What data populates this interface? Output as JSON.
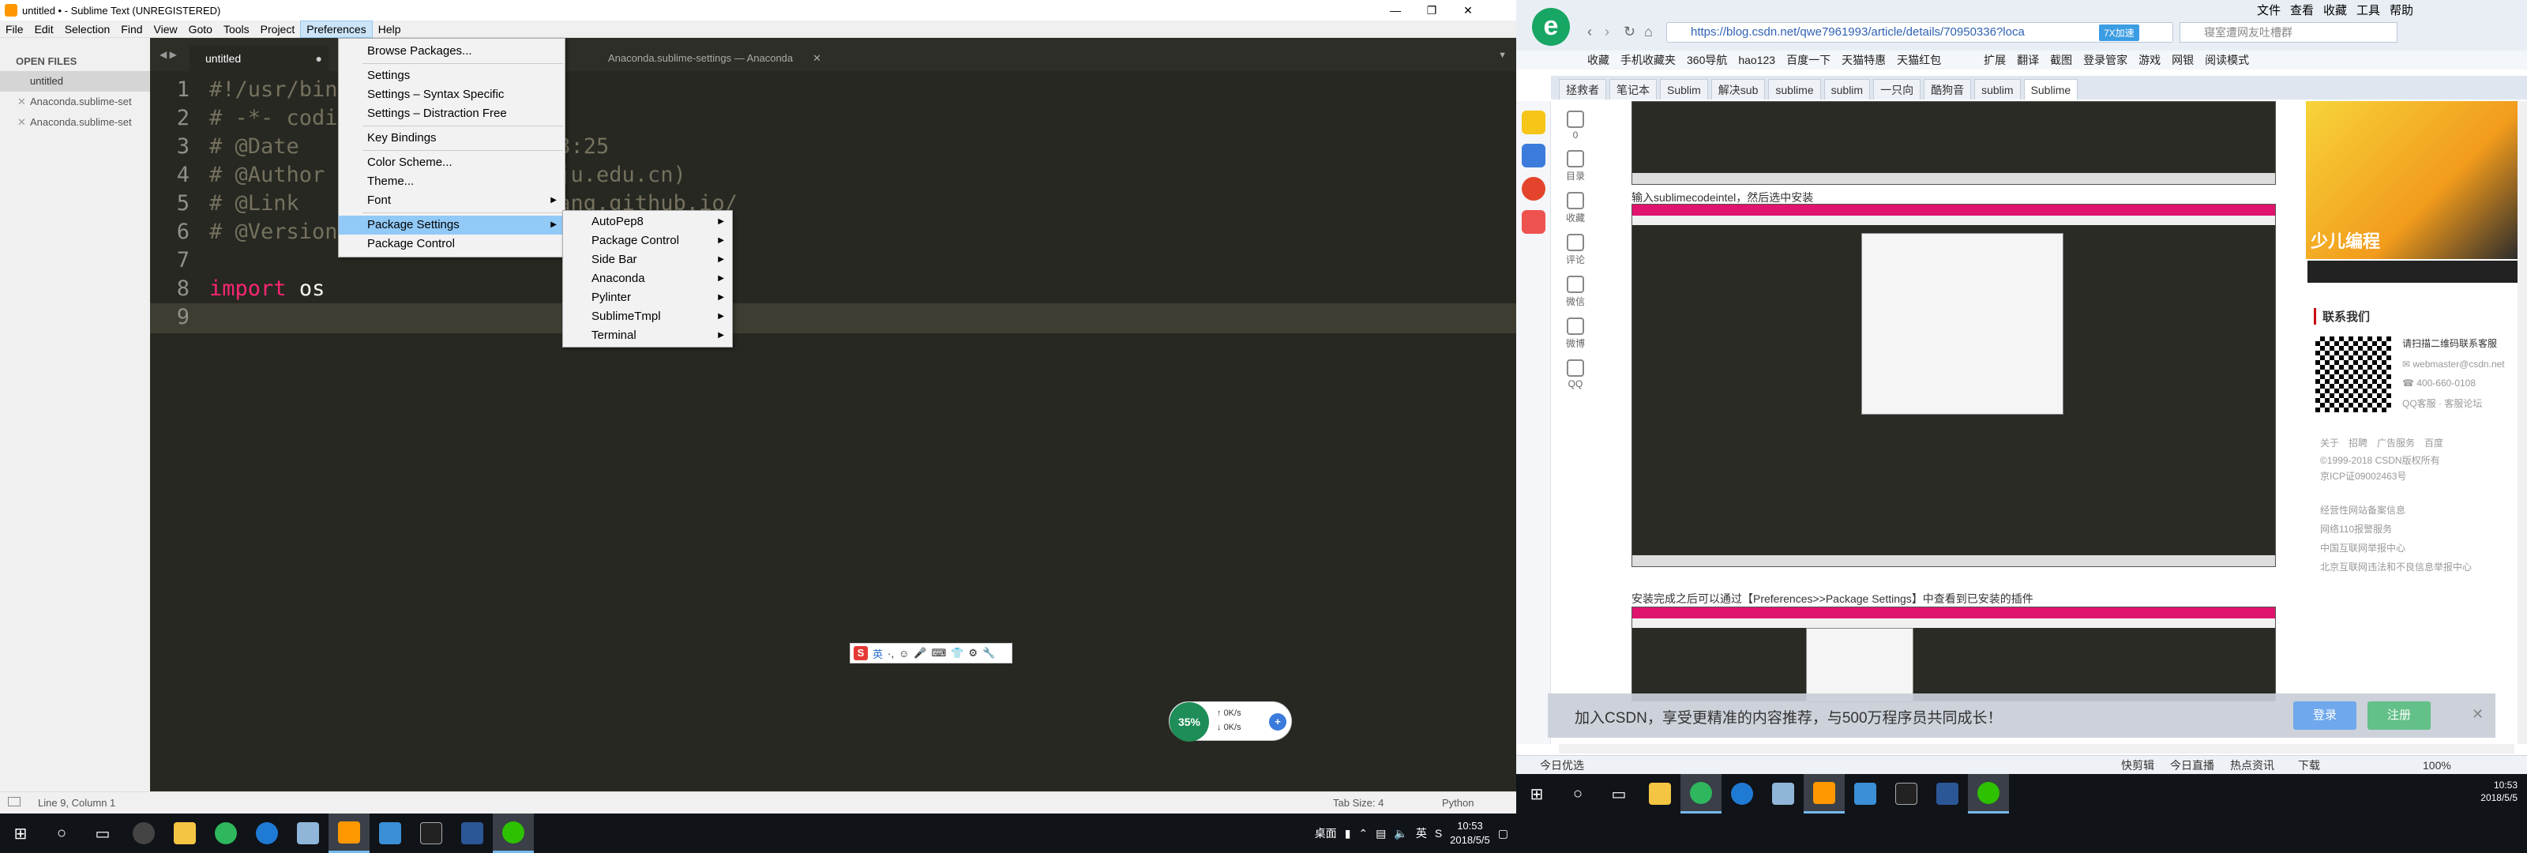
{
  "sublime": {
    "title": "untitled • - Sublime Text (UNREGISTERED)",
    "menu": [
      "File",
      "Edit",
      "Selection",
      "Find",
      "View",
      "Goto",
      "Tools",
      "Project",
      "Preferences",
      "Help"
    ],
    "sidebar": {
      "header": "OPEN FILES",
      "files": [
        "untitled",
        "Anaconda.sublime-set",
        "Anaconda.sublime-set"
      ]
    },
    "tabs": [
      "untitled",
      "Anaconda.sublime-settings — Anaconda"
    ],
    "code": [
      {
        "n": "1",
        "text": "#!/usr/bin"
      },
      {
        "n": "2",
        "text": "# -*- codi"
      },
      {
        "n": "3",
        "text": "# @Date",
        "tail": "53:25"
      },
      {
        "n": "4",
        "text": "# @Author",
        "tail": "zju.edu.cn)"
      },
      {
        "n": "5",
        "text": "# @Link",
        "tail": "iang.github.io/"
      },
      {
        "n": "6",
        "text": "# @Version"
      },
      {
        "n": "7",
        "text": ""
      },
      {
        "n": "8",
        "kw": "import",
        "id": "os"
      },
      {
        "n": "9",
        "text": ""
      }
    ],
    "prefs_menu": [
      "Browse Packages...",
      "Settings",
      "Settings – Syntax Specific",
      "Settings – Distraction Free",
      "Key Bindings",
      "Color Scheme...",
      "Theme...",
      "Font",
      "Package Settings",
      "Package Control"
    ],
    "pkg_menu": [
      "AutoPep8",
      "Package Control",
      "Side Bar",
      "Anaconda",
      "Pylinter",
      "SublimeTmpl",
      "Terminal"
    ],
    "status": {
      "position": "Line 9, Column 1",
      "tabsize": "Tab Size: 4",
      "syntax": "Python"
    }
  },
  "netwidget": {
    "percent": "35%",
    "up": "0K/s",
    "down": "0K/s"
  },
  "taskbar_left": {
    "ime": "桌面",
    "time": "10:53",
    "date": "2018/5/5"
  },
  "browser": {
    "logo": "e",
    "menu": [
      "文件",
      "查看",
      "收藏",
      "工具",
      "帮助"
    ],
    "url": "https://blog.csdn.net/qwe7961993/article/details/70950336?loca",
    "btn_7x": "7X加速",
    "search_placeholder": "寝室遭网友吐槽群",
    "favbar": [
      "收藏",
      "手机收藏夹",
      "360导航",
      "hao123",
      "百度一下",
      "天猫特惠",
      "天猫红包",
      "扩展",
      "翻译",
      "截图",
      "登录管家",
      "游戏",
      "网银",
      "阅读模式"
    ],
    "tabs": [
      "拯救者",
      "笔记本",
      "Sublim",
      "解决sub",
      "sublime",
      "sublim",
      "一只向",
      "酷狗音",
      "sublim",
      "Sublime"
    ],
    "side_actions": [
      {
        "n": "0",
        "l": "点赞"
      },
      {
        "n": "",
        "l": "目录"
      },
      {
        "n": "",
        "l": "收藏"
      },
      {
        "n": "",
        "l": "评论"
      },
      {
        "n": "",
        "l": "微信"
      },
      {
        "n": "",
        "l": "微博"
      },
      {
        "n": "",
        "l": "QQ"
      }
    ],
    "article_text1": "输入sublimecodeintel，然后选中安装",
    "article_text2": "安装完成之后可以通过【Preferences>>Package Settings】中查看到已安装的插件",
    "banner": "少儿编程",
    "contact": "联系我们",
    "qr_text": "请扫描二维码联系客服",
    "email": "webmaster@csdn.net",
    "phone": "400-660-0108",
    "qq": "QQ客服",
    "forum": "客服论坛",
    "links": [
      "关于",
      "招聘",
      "广告服务",
      "百度"
    ],
    "copyright": "©1999-2018 CSDN版权所有",
    "icp": "京ICP证09002463号",
    "legal": [
      "经营性网站备案信息",
      "网络110报警服务",
      "中国互联网举报中心",
      "北京互联网违法和不良信息举报中心"
    ],
    "promo": "加入CSDN，享受更精准的内容推荐，与500万程序员共同成长！",
    "login": "登录",
    "register": "注册",
    "status": [
      "今日优选",
      "快剪辑",
      "今日直播",
      "热点资讯",
      "下载",
      "100%"
    ]
  },
  "taskbar_right": {
    "time": "10:53",
    "date": "2018/5/5"
  },
  "colors": {
    "accent": "#3b7bdc",
    "st_bg": "#272822",
    "keyword": "#f92672",
    "csdn_red": "#ca0c16"
  }
}
